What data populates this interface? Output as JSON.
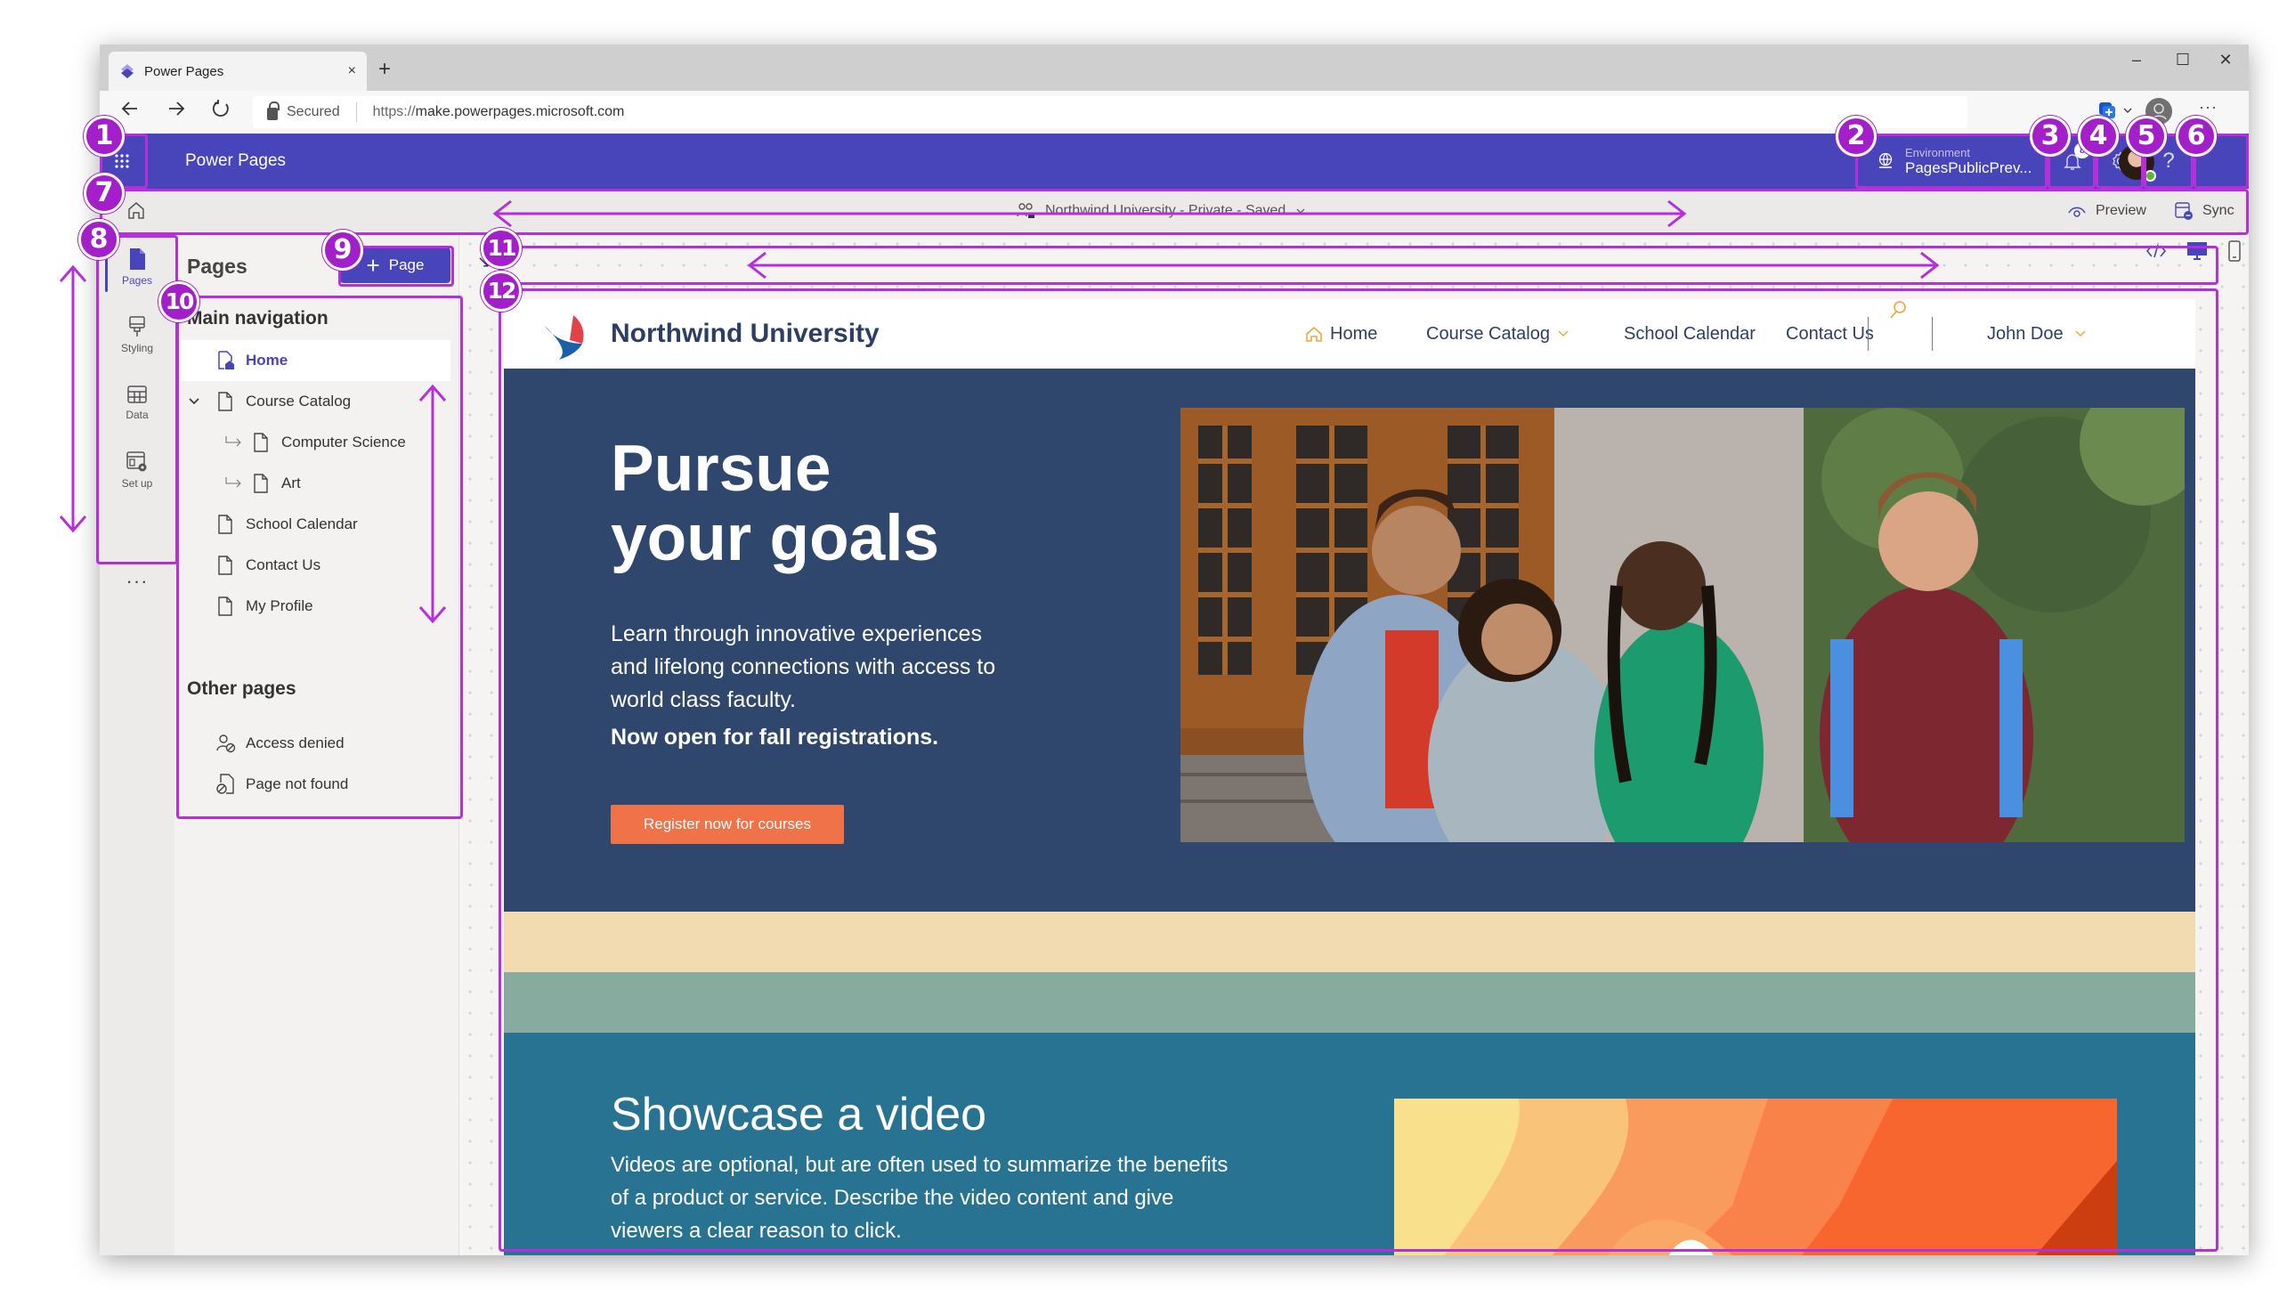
{
  "browser": {
    "tab_title": "Power Pages",
    "tab_close": "×",
    "new_tab": "+",
    "secured_label": "Secured",
    "url_prefix": "https://",
    "url_host": "make.powerpages.microsoft.com",
    "window_controls": {
      "minimize": "–",
      "maximize": "☐",
      "close": "✕"
    },
    "more": "···"
  },
  "app_header": {
    "title": "Power Pages",
    "environment_label": "Environment",
    "environment_value": "PagesPublicPrev...",
    "notification_count": "8"
  },
  "command_bar": {
    "site_status": "Northwind University - Private - Saved",
    "preview_label": "Preview",
    "sync_label": "Sync"
  },
  "rail": {
    "items": [
      {
        "label": "Pages",
        "icon": "page-icon",
        "active": true
      },
      {
        "label": "Styling",
        "icon": "paintbrush-icon",
        "active": false
      },
      {
        "label": "Data",
        "icon": "table-icon",
        "active": false
      },
      {
        "label": "Set up",
        "icon": "setup-icon",
        "active": false
      }
    ],
    "more": "···"
  },
  "pages_panel": {
    "title": "Pages",
    "add_button": "Page",
    "main_nav_heading": "Main navigation",
    "main_nav": [
      {
        "label": "Home",
        "level": 0,
        "selected": true,
        "icon": "home-page-icon"
      },
      {
        "label": "Course Catalog",
        "level": 0,
        "expanded": true,
        "icon": "page-icon"
      },
      {
        "label": "Computer Science",
        "level": 1,
        "icon": "page-icon"
      },
      {
        "label": "Art",
        "level": 1,
        "icon": "page-icon"
      },
      {
        "label": "School Calendar",
        "level": 0,
        "icon": "page-icon"
      },
      {
        "label": "Contact Us",
        "level": 0,
        "icon": "page-icon"
      },
      {
        "label": "My Profile",
        "level": 0,
        "icon": "page-icon"
      }
    ],
    "other_heading": "Other pages",
    "other_pages": [
      {
        "label": "Access denied",
        "icon": "access-denied-icon"
      },
      {
        "label": "Page not found",
        "icon": "page-not-found-icon"
      }
    ]
  },
  "site": {
    "brand": "Northwind University",
    "nav": {
      "home": "Home",
      "course_catalog": "Course Catalog",
      "school_calendar": "School Calendar",
      "contact_us": "Contact Us",
      "user": "John Doe"
    },
    "hero": {
      "title_line1": "Pursue",
      "title_line2": "your goals",
      "text": "Learn through innovative experiences and lifelong connections with access to world class faculty.",
      "bold": "Now open for fall registrations.",
      "cta": "Register now for courses"
    },
    "video": {
      "title": "Showcase a video",
      "text": "Videos are optional, but are often used to summarize the benefits of a product or service. Describe the video content and give viewers a clear reason to click."
    }
  },
  "annotations": [
    "1",
    "2",
    "3",
    "4",
    "5",
    "6",
    "7",
    "8",
    "9",
    "10",
    "11",
    "12"
  ],
  "colors": {
    "brand_purple": "#4845bb",
    "hero_navy": "#2f466d",
    "cta_orange": "#f07249",
    "band_sand": "#f2dbb1",
    "band_sage": "#88aba0",
    "video_teal": "#287392",
    "annotation_magenta": "#a21fc9"
  }
}
